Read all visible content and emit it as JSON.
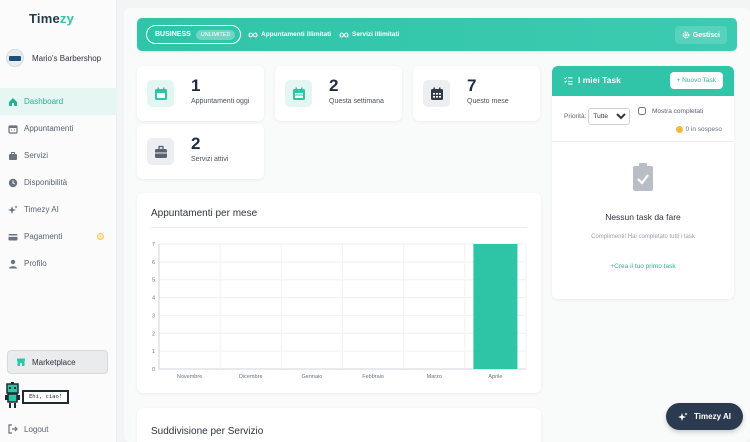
{
  "app": {
    "logo_main": "Time",
    "logo_accent": "zy"
  },
  "shop": {
    "name": "Mario's Barbershop"
  },
  "sidebar": {
    "items": [
      {
        "label": "Dashboard",
        "icon": "home-icon"
      },
      {
        "label": "Appuntamenti",
        "icon": "calendar-icon"
      },
      {
        "label": "Servizi",
        "icon": "briefcase-icon"
      },
      {
        "label": "Disponibilità",
        "icon": "clock-icon"
      },
      {
        "label": "Timezy AI",
        "icon": "sparkle-icon"
      },
      {
        "label": "Pagamenti",
        "icon": "credit-card-icon"
      },
      {
        "label": "Profilo",
        "icon": "user-icon"
      }
    ],
    "marketplace": "Marketplace",
    "mascot_speech": "Ehi, ciao!",
    "logout": "Logout"
  },
  "banner": {
    "plan": "BUSINESS",
    "plan_badge": "UNLIMITED",
    "feature1": "Appuntamenti illimitati",
    "feature2": "Servizi illimitati",
    "manage": "Gestisci"
  },
  "stats": [
    {
      "value": "1",
      "label": "Appuntamenti oggi"
    },
    {
      "value": "2",
      "label": "Questa settimana"
    },
    {
      "value": "7",
      "label": "Questo mese"
    },
    {
      "value": "2",
      "label": "Servizi attivi"
    }
  ],
  "chart_section": {
    "title": "Appuntamenti per mese"
  },
  "chart_data": {
    "type": "bar",
    "categories": [
      "Novembre",
      "Dicembre",
      "Gennaio",
      "Febbraio",
      "Marzo",
      "Aprile"
    ],
    "values": [
      0,
      0,
      0,
      0,
      0,
      7
    ],
    "ylim": [
      0,
      7
    ],
    "yticks": [
      0,
      1,
      2,
      3,
      4,
      5,
      6,
      7
    ],
    "grid": true,
    "bar_color": "#2ec4a6"
  },
  "services_section": {
    "title": "Suddivisione per Servizio"
  },
  "tasks": {
    "title": "I miei Task",
    "new_task": "+ Nuovo Task",
    "priority_label": "Priorità:",
    "priority_value": "Tutte",
    "show_completed": "Mostra completati",
    "pending": "0 in sospeso",
    "empty_title": "Nessun task da fare",
    "empty_sub": "Complimenti! Hai completato tutti i task",
    "create_first": "+Crea il tuo primo task"
  },
  "ai_button": {
    "label": "Timezy AI"
  },
  "colors": {
    "accent": "#2ec4a6",
    "dark": "#2b3a4f"
  }
}
